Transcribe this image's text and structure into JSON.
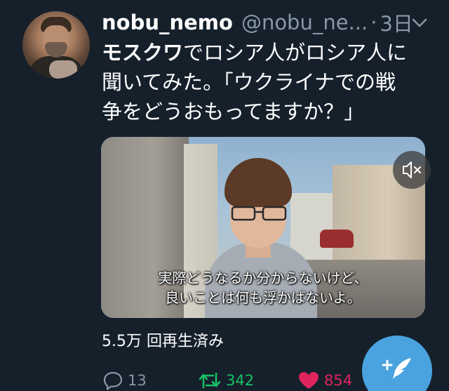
{
  "tweet": {
    "author": {
      "name": "nobu_nemo",
      "handle": "@nobu_ne...",
      "separator": "·",
      "time": "3日"
    },
    "text": {
      "line1_bold": "モスクワ",
      "line1_rest": "でロシア人がロシア人に",
      "line2": "聞いてみた。「ウクライナでの戦",
      "line3": "争をどうおもってますか？」"
    },
    "video": {
      "subtitle_line1": "実際どうなるか分からないけど、",
      "subtitle_line2": "良いことは何も浮かばないよ。",
      "muted": true
    },
    "views": "5.5万 回再生済み",
    "actions": {
      "reply_count": "13",
      "retweet_count": "342",
      "like_count": "854"
    }
  },
  "colors": {
    "background": "#15202b",
    "secondary_text": "#8899a6",
    "retweet": "#17bf63",
    "like": "#e0245e",
    "fab": "#4aa3df"
  },
  "icons": {
    "menu": "chevron-down-icon",
    "mute": "speaker-muted-icon",
    "reply": "reply-icon",
    "retweet": "retweet-icon",
    "like": "heart-icon",
    "compose": "compose-feather-icon"
  }
}
